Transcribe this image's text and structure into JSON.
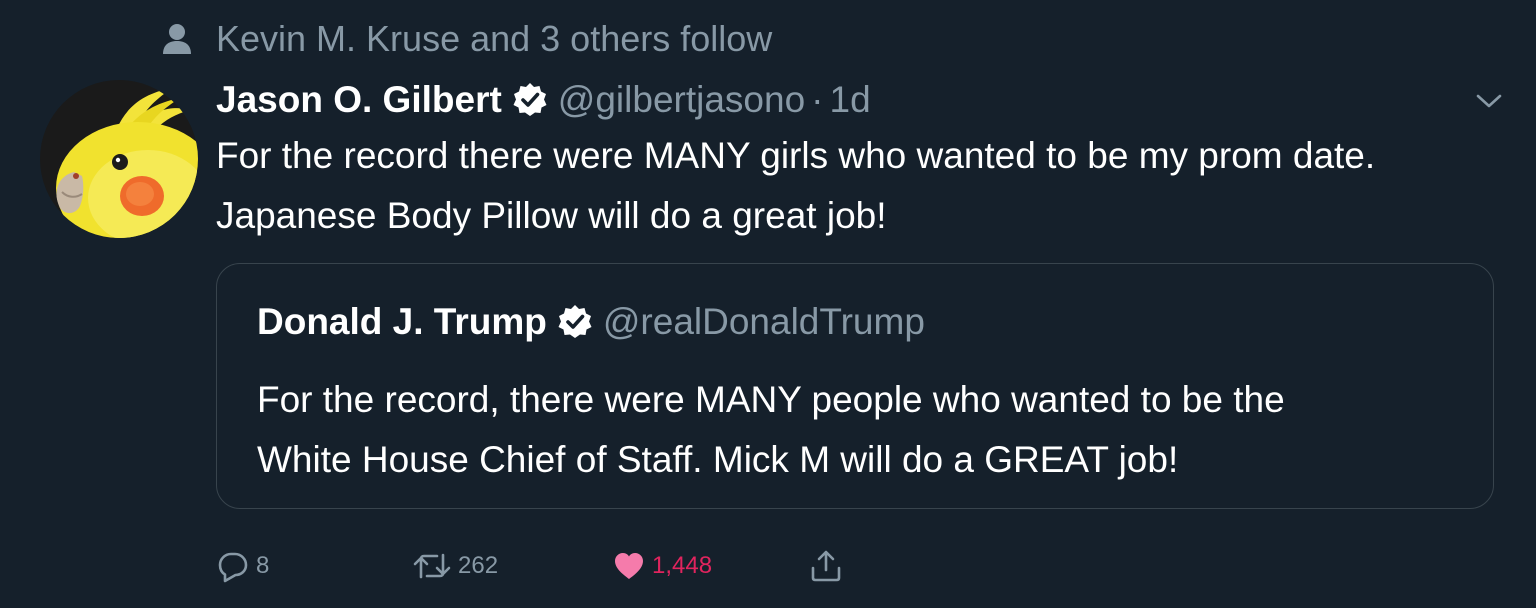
{
  "social_context": {
    "text": "Kevin M. Kruse and 3 others follow",
    "icon": "person-icon"
  },
  "tweet": {
    "author_name": "Jason O. Gilbert",
    "verified": true,
    "handle": "@gilbertjasono",
    "separator": "·",
    "time": "1d",
    "text_line1": "For the record there were MANY girls who wanted to be my prom date.",
    "text_line2": "Japanese Body Pillow will do a great job!",
    "avatar_icon": "cockatiel-avatar"
  },
  "quoted_tweet": {
    "author_name": "Donald J. Trump",
    "verified": true,
    "handle": "@realDonaldTrump",
    "text_line1": "For the record, there were MANY people who wanted to be the",
    "text_line2": "White House Chief of Staff. Mick M will do a GREAT job!"
  },
  "actions": {
    "reply_count": "8",
    "retweet_count": "262",
    "like_count": "1,448",
    "liked": true,
    "icons": [
      "reply-icon",
      "retweet-icon",
      "heart-icon",
      "share-icon"
    ]
  },
  "colors": {
    "background": "#15202b",
    "text_primary": "#ffffff",
    "text_secondary": "#8899a6",
    "border": "#38444d",
    "like": "#e0245e"
  }
}
